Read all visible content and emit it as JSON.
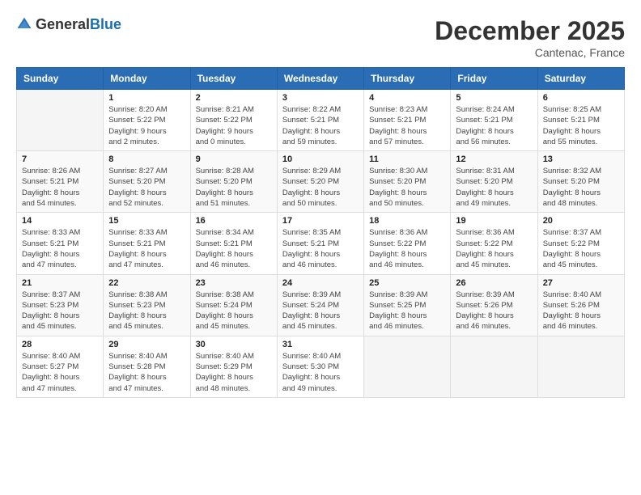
{
  "header": {
    "logo_general": "General",
    "logo_blue": "Blue",
    "title": "December 2025",
    "location": "Cantenac, France"
  },
  "calendar": {
    "days_of_week": [
      "Sunday",
      "Monday",
      "Tuesday",
      "Wednesday",
      "Thursday",
      "Friday",
      "Saturday"
    ],
    "weeks": [
      [
        {
          "day": "",
          "content": ""
        },
        {
          "day": "1",
          "content": "Sunrise: 8:20 AM\nSunset: 5:22 PM\nDaylight: 9 hours\nand 2 minutes."
        },
        {
          "day": "2",
          "content": "Sunrise: 8:21 AM\nSunset: 5:22 PM\nDaylight: 9 hours\nand 0 minutes."
        },
        {
          "day": "3",
          "content": "Sunrise: 8:22 AM\nSunset: 5:21 PM\nDaylight: 8 hours\nand 59 minutes."
        },
        {
          "day": "4",
          "content": "Sunrise: 8:23 AM\nSunset: 5:21 PM\nDaylight: 8 hours\nand 57 minutes."
        },
        {
          "day": "5",
          "content": "Sunrise: 8:24 AM\nSunset: 5:21 PM\nDaylight: 8 hours\nand 56 minutes."
        },
        {
          "day": "6",
          "content": "Sunrise: 8:25 AM\nSunset: 5:21 PM\nDaylight: 8 hours\nand 55 minutes."
        }
      ],
      [
        {
          "day": "7",
          "content": "Sunrise: 8:26 AM\nSunset: 5:21 PM\nDaylight: 8 hours\nand 54 minutes."
        },
        {
          "day": "8",
          "content": "Sunrise: 8:27 AM\nSunset: 5:20 PM\nDaylight: 8 hours\nand 52 minutes."
        },
        {
          "day": "9",
          "content": "Sunrise: 8:28 AM\nSunset: 5:20 PM\nDaylight: 8 hours\nand 51 minutes."
        },
        {
          "day": "10",
          "content": "Sunrise: 8:29 AM\nSunset: 5:20 PM\nDaylight: 8 hours\nand 50 minutes."
        },
        {
          "day": "11",
          "content": "Sunrise: 8:30 AM\nSunset: 5:20 PM\nDaylight: 8 hours\nand 50 minutes."
        },
        {
          "day": "12",
          "content": "Sunrise: 8:31 AM\nSunset: 5:20 PM\nDaylight: 8 hours\nand 49 minutes."
        },
        {
          "day": "13",
          "content": "Sunrise: 8:32 AM\nSunset: 5:20 PM\nDaylight: 8 hours\nand 48 minutes."
        }
      ],
      [
        {
          "day": "14",
          "content": "Sunrise: 8:33 AM\nSunset: 5:21 PM\nDaylight: 8 hours\nand 47 minutes."
        },
        {
          "day": "15",
          "content": "Sunrise: 8:33 AM\nSunset: 5:21 PM\nDaylight: 8 hours\nand 47 minutes."
        },
        {
          "day": "16",
          "content": "Sunrise: 8:34 AM\nSunset: 5:21 PM\nDaylight: 8 hours\nand 46 minutes."
        },
        {
          "day": "17",
          "content": "Sunrise: 8:35 AM\nSunset: 5:21 PM\nDaylight: 8 hours\nand 46 minutes."
        },
        {
          "day": "18",
          "content": "Sunrise: 8:36 AM\nSunset: 5:22 PM\nDaylight: 8 hours\nand 46 minutes."
        },
        {
          "day": "19",
          "content": "Sunrise: 8:36 AM\nSunset: 5:22 PM\nDaylight: 8 hours\nand 45 minutes."
        },
        {
          "day": "20",
          "content": "Sunrise: 8:37 AM\nSunset: 5:22 PM\nDaylight: 8 hours\nand 45 minutes."
        }
      ],
      [
        {
          "day": "21",
          "content": "Sunrise: 8:37 AM\nSunset: 5:23 PM\nDaylight: 8 hours\nand 45 minutes."
        },
        {
          "day": "22",
          "content": "Sunrise: 8:38 AM\nSunset: 5:23 PM\nDaylight: 8 hours\nand 45 minutes."
        },
        {
          "day": "23",
          "content": "Sunrise: 8:38 AM\nSunset: 5:24 PM\nDaylight: 8 hours\nand 45 minutes."
        },
        {
          "day": "24",
          "content": "Sunrise: 8:39 AM\nSunset: 5:24 PM\nDaylight: 8 hours\nand 45 minutes."
        },
        {
          "day": "25",
          "content": "Sunrise: 8:39 AM\nSunset: 5:25 PM\nDaylight: 8 hours\nand 46 minutes."
        },
        {
          "day": "26",
          "content": "Sunrise: 8:39 AM\nSunset: 5:26 PM\nDaylight: 8 hours\nand 46 minutes."
        },
        {
          "day": "27",
          "content": "Sunrise: 8:40 AM\nSunset: 5:26 PM\nDaylight: 8 hours\nand 46 minutes."
        }
      ],
      [
        {
          "day": "28",
          "content": "Sunrise: 8:40 AM\nSunset: 5:27 PM\nDaylight: 8 hours\nand 47 minutes."
        },
        {
          "day": "29",
          "content": "Sunrise: 8:40 AM\nSunset: 5:28 PM\nDaylight: 8 hours\nand 47 minutes."
        },
        {
          "day": "30",
          "content": "Sunrise: 8:40 AM\nSunset: 5:29 PM\nDaylight: 8 hours\nand 48 minutes."
        },
        {
          "day": "31",
          "content": "Sunrise: 8:40 AM\nSunset: 5:30 PM\nDaylight: 8 hours\nand 49 minutes."
        },
        {
          "day": "",
          "content": ""
        },
        {
          "day": "",
          "content": ""
        },
        {
          "day": "",
          "content": ""
        }
      ]
    ]
  }
}
